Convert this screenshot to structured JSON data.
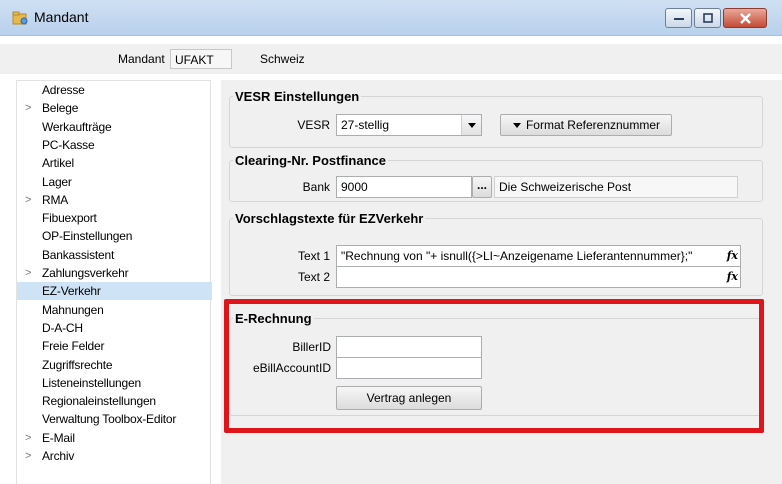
{
  "window": {
    "title": "Mandant",
    "icon": "app-folder-icon",
    "controls": [
      "minimize-icon",
      "maximize-icon",
      "close-icon"
    ]
  },
  "header": {
    "mandant_label": "Mandant",
    "mandant_code": "UFAKT",
    "mandant_name": "Schweiz"
  },
  "sidebar": {
    "items": [
      {
        "label": "Adresse",
        "expandable": false
      },
      {
        "label": "Belege",
        "expandable": true
      },
      {
        "label": "Werkaufträge",
        "expandable": false
      },
      {
        "label": "PC-Kasse",
        "expandable": false
      },
      {
        "label": "Artikel",
        "expandable": false
      },
      {
        "label": "Lager",
        "expandable": false
      },
      {
        "label": "RMA",
        "expandable": true
      },
      {
        "label": "Fibuexport",
        "expandable": false
      },
      {
        "label": "OP-Einstellungen",
        "expandable": false
      },
      {
        "label": "Bankassistent",
        "expandable": false
      },
      {
        "label": "Zahlungsverkehr",
        "expandable": true
      },
      {
        "label": "EZ-Verkehr",
        "expandable": false,
        "selected": true
      },
      {
        "label": "Mahnungen",
        "expandable": false
      },
      {
        "label": "D-A-CH",
        "expandable": false
      },
      {
        "label": "Freie Felder",
        "expandable": false
      },
      {
        "label": "Zugriffsrechte",
        "expandable": false
      },
      {
        "label": "Listeneinstellungen",
        "expandable": false
      },
      {
        "label": "Regionaleinstellungen",
        "expandable": false
      },
      {
        "label": "Verwaltung Toolbox-Editor",
        "expandable": false
      },
      {
        "label": "E-Mail",
        "expandable": true
      },
      {
        "label": "Archiv",
        "expandable": true
      }
    ]
  },
  "vesr": {
    "title": "VESR Einstellungen",
    "label": "VESR",
    "value": "27-stellig",
    "format_button": "Format Referenznummer"
  },
  "clearing": {
    "title": "Clearing-Nr. Postfinance",
    "bank_label": "Bank",
    "bank_value": "9000",
    "browse_label": "...",
    "bank_name": "Die Schweizerische Post"
  },
  "vorschlag": {
    "title": "Vorschlagstexte für EZVerkehr",
    "text1_label": "Text 1",
    "text1_value": "\"Rechnung von \"+ isnull({>LI~Anzeigename Lieferantennummer};\"",
    "text2_label": "Text 2",
    "text2_value": "",
    "fx_label": "fx"
  },
  "erechnung": {
    "title": "E-Rechnung",
    "biller_label": "BillerID",
    "biller_value": "",
    "ebill_label": "eBillAccountID",
    "ebill_value": "",
    "button": "Vertrag anlegen"
  },
  "colors": {
    "highlight": "#e0141b",
    "selection": "#cfe3f7"
  }
}
